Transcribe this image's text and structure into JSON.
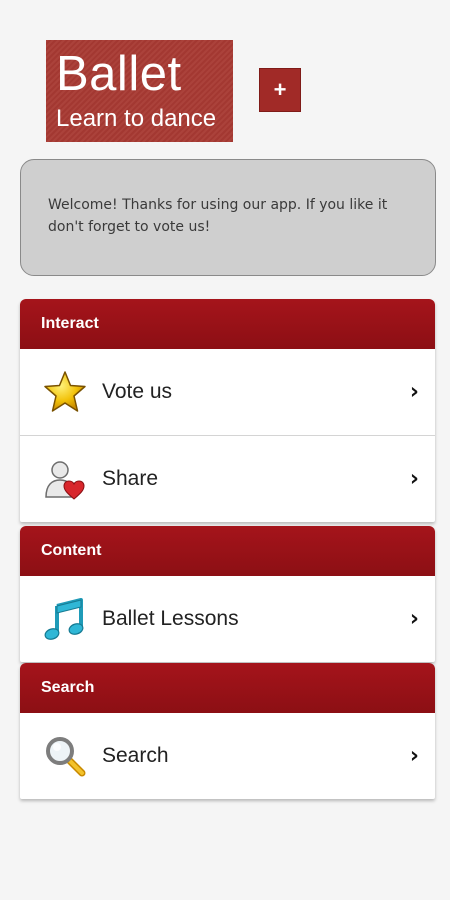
{
  "logo": {
    "title": "Ballet",
    "subtitle": "Learn to dance"
  },
  "add_button": {
    "label": "+"
  },
  "welcome": {
    "text": "Welcome! Thanks for using our app. If you like it don't forget to vote us!"
  },
  "sections": [
    {
      "header": "Interact",
      "items": [
        {
          "label": "Vote us",
          "icon": "star-icon"
        },
        {
          "label": "Share",
          "icon": "share-person-heart-icon"
        }
      ]
    },
    {
      "header": "Content",
      "items": [
        {
          "label": "Ballet Lessons",
          "icon": "music-note-icon"
        }
      ]
    },
    {
      "header": "Search",
      "items": [
        {
          "label": "Search",
          "icon": "magnifier-icon"
        }
      ]
    }
  ],
  "chevron": "›",
  "colors": {
    "brand": "#a83a33",
    "header": "#9a1218",
    "background": "#f5f5f5"
  }
}
